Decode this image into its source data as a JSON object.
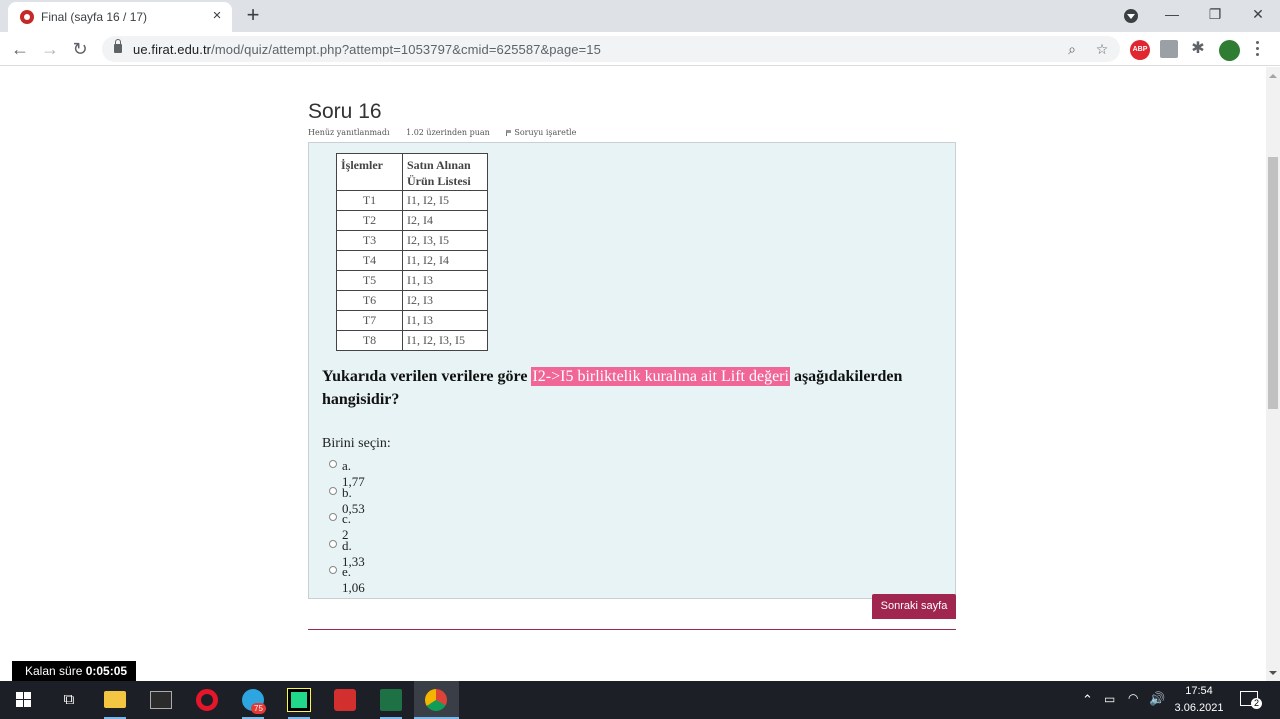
{
  "browser": {
    "tab_title": "Final (sayfa 16 / 17)",
    "tab_close": "×",
    "new_tab": "+",
    "window_minimize": "—",
    "window_restore": "❐",
    "window_close": "✕",
    "url_domain": "ue.firat.edu.tr",
    "url_path": "/mod/quiz/attempt.php?attempt=1053797&cmid=625587&page=15",
    "extension_abp": "ABP"
  },
  "question": {
    "title": "Soru 16",
    "status": "Henüz yanıtlanmadı",
    "points": "1.02 üzerinden puan",
    "flag_label": "Soruyu işaretle",
    "table": {
      "headers": [
        "İşlemler",
        "Satın Alınan Ürün Listesi"
      ],
      "rows": [
        [
          "T1",
          "I1, I2, I5"
        ],
        [
          "T2",
          "I2, I4"
        ],
        [
          "T3",
          "I2, I3, I5"
        ],
        [
          "T4",
          "I1, I2, I4"
        ],
        [
          "T5",
          "I1, I3"
        ],
        [
          "T6",
          "I2, I3"
        ],
        [
          "T7",
          "I1, I3"
        ],
        [
          "T8",
          "I1, I2, I3, I5"
        ]
      ]
    },
    "text_before": "Yukarıda verilen verilere göre ",
    "text_highlight": "I2->I5 birliktelik kuralına ait Lift değeri",
    "text_after": " aşağıdakilerden hangisidir?",
    "prompt": "Birini seçin:",
    "answers": [
      "a. 1,77",
      "b. 0,53",
      "c. 2",
      "d. 1,33",
      "e. 1,06"
    ]
  },
  "navigation": {
    "next_button": "Sonraki sayfa"
  },
  "timer": {
    "label": "Kalan süre ",
    "value": "0:05:05"
  },
  "taskbar": {
    "telegram_badge": "75",
    "time": "17:54",
    "date": "3.06.2021",
    "notifications": "2"
  },
  "colors": {
    "accent": "#a0264f",
    "highlight": "#f06696",
    "question_bg": "#e7f3f5"
  }
}
